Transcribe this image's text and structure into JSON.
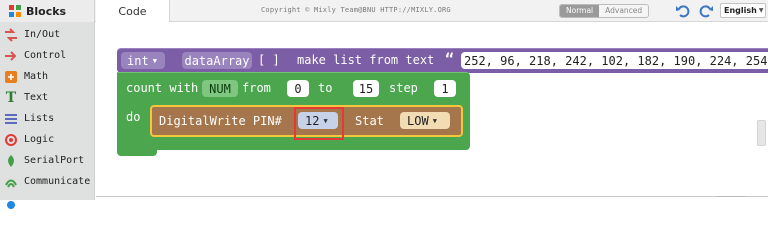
{
  "app": {
    "brand": "Blocks",
    "tab_code": "Code",
    "copyright": "Copyright © Mixly Team@BNU HTTP://MIXLY.ORG",
    "mode_normal": "Normal",
    "mode_advanced": "Advanced",
    "language": "English"
  },
  "sidebar": {
    "items": [
      {
        "label": "In/Out",
        "icon": "in-out-icon",
        "color": "#d9534f"
      },
      {
        "label": "Control",
        "icon": "control-icon",
        "color": "#d9534f"
      },
      {
        "label": "Math",
        "icon": "math-icon",
        "color": "#e67e22"
      },
      {
        "label": "Text",
        "icon": "text-icon",
        "color": "#2e7d32"
      },
      {
        "label": "Lists",
        "icon": "lists-icon",
        "color": "#5c6bc0"
      },
      {
        "label": "Logic",
        "icon": "logic-icon",
        "color": "#e53935"
      },
      {
        "label": "SerialPort",
        "icon": "serialport-icon",
        "color": "#43a047"
      },
      {
        "label": "Communicate",
        "icon": "communicate-icon",
        "color": "#43a047"
      }
    ]
  },
  "blocks": {
    "list": {
      "type": "int",
      "var": "dataArray",
      "brackets": "[ ]",
      "text": "make list from text",
      "quote": "“",
      "values": "252, 96, 218, 242, 102, 182, 190, 224, 254"
    },
    "loop": {
      "count_with": "count with",
      "var": "NUM",
      "from_label": "from",
      "from": "0",
      "to_label": "to",
      "to": "15",
      "step_label": "step",
      "step": "1",
      "do_label": "do"
    },
    "write": {
      "label": "DigitalWrite PIN#",
      "pin": "12",
      "stat_label": "Stat",
      "stat": "LOW"
    }
  },
  "colors": {
    "list_block": "#7b5ea6",
    "loop_block": "#4ca64e",
    "io_block": "#a5754b",
    "selected_outline": "#f3c63c",
    "highlight_box": "#e53935"
  }
}
